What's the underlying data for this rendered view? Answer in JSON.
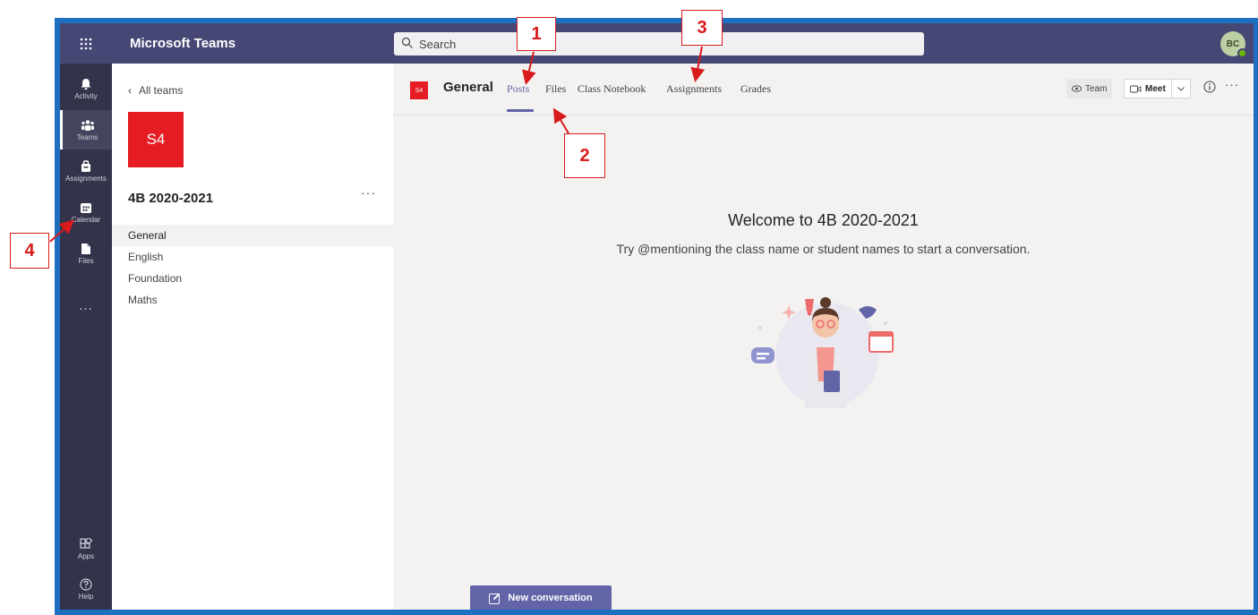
{
  "titlebar": {
    "app_title": "Microsoft Teams",
    "search_placeholder": "Search",
    "avatar_initials": "BC"
  },
  "rail": {
    "items": [
      {
        "label": "Activity",
        "icon": "bell-icon"
      },
      {
        "label": "Teams",
        "icon": "teams-icon"
      },
      {
        "label": "Assignments",
        "icon": "assignments-icon"
      },
      {
        "label": "Calendar",
        "icon": "calendar-icon"
      },
      {
        "label": "Files",
        "icon": "file-icon"
      },
      {
        "label": "...",
        "icon": "more-icon"
      },
      {
        "label": "Apps",
        "icon": "apps-icon"
      },
      {
        "label": "Help",
        "icon": "help-icon"
      }
    ]
  },
  "panel": {
    "back_label": "All teams",
    "team_tile": "S4",
    "team_name": "4B 2020-2021",
    "more": "···",
    "channels": [
      "General",
      "English",
      "Foundation",
      "Maths"
    ]
  },
  "main": {
    "channel_icon": "S4",
    "channel_title": "General",
    "tabs": [
      "Posts",
      "Files",
      "Class Notebook",
      "Assignments",
      "Grades"
    ],
    "active_tab": "Posts",
    "team_button": "Team",
    "meet_button": "Meet",
    "welcome": "Welcome to 4B 2020-2021",
    "subtitle": "Try @mentioning the class name or student names to start a conversation.",
    "new_conversation": "New conversation"
  },
  "callouts": [
    "1",
    "2",
    "3",
    "4"
  ],
  "colors": {
    "titlebar": "#464775",
    "rail": "#33344a",
    "accent": "#6264a7",
    "team_red": "#e51c23",
    "frame_blue": "#1e6fbf",
    "callout_red": "#d81b1b"
  }
}
